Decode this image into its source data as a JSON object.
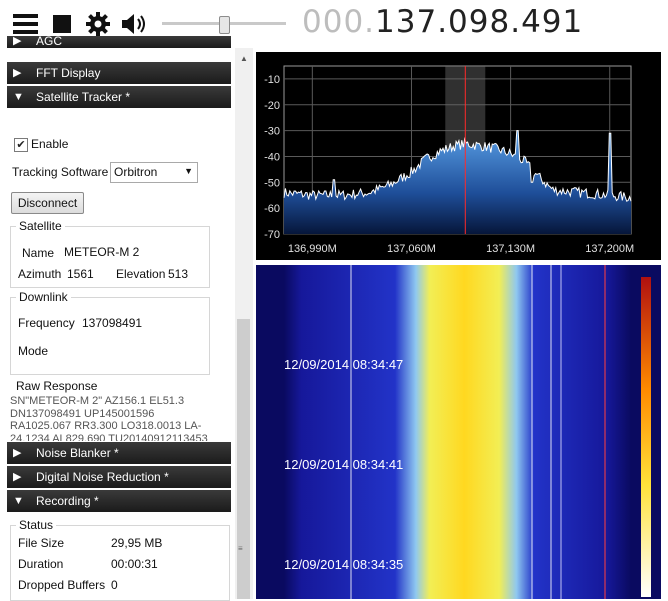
{
  "toolbar": {
    "frequency_dim": "000.",
    "frequency_main": "137.098.491",
    "slider_level": 0.5
  },
  "panels": {
    "agc_partial": "AGC",
    "fft_display": "FFT Display",
    "satellite_tracker": "Satellite Tracker *",
    "noise_blanker": "Noise Blanker *",
    "digital_noise_reduction": "Digital Noise Reduction *",
    "recording": "Recording *"
  },
  "tracker": {
    "enable_label": "Enable",
    "tracking_software_label": "Tracking Software",
    "tracking_software_value": "Orbitron",
    "disconnect_label": "Disconnect",
    "satellite_group": "Satellite",
    "name_label": "Name",
    "name_value": "METEOR-M 2",
    "azimuth_label": "Azimuth",
    "azimuth_value": "1561",
    "elevation_label": "Elevation",
    "elevation_value": "513",
    "downlink_group": "Downlink",
    "frequency_label": "Frequency",
    "frequency_value": "137098491",
    "mode_label": "Mode",
    "raw_response_label": "Raw Response",
    "raw_response_text": "SN\"METEOR-M 2\" AZ156.1 EL51.3\nDN137098491 UP145001596\nRA1025.067 RR3.300 LO318.0013 LA-\n24.1234 AL829.690 TU20140912113453"
  },
  "recording": {
    "status_group": "Status",
    "file_size_label": "File Size",
    "file_size_value": "29,95 MB",
    "duration_label": "Duration",
    "duration_value": "00:00:31",
    "dropped_label": "Dropped Buffers",
    "dropped_value": "0"
  },
  "chart_data": {
    "type": "area",
    "y_ticks": [
      "-10",
      "-20",
      "-30",
      "-40",
      "-50",
      "-60",
      "-70"
    ],
    "x_ticks": [
      "136,990M",
      "137,060M",
      "137,130M",
      "137,200M"
    ],
    "ylim": [
      -70,
      -5
    ],
    "xlim": [
      136.97,
      137.215
    ],
    "grid": true,
    "center_frequency": 137.098,
    "x": [
      136.97,
      136.99,
      137.01,
      137.03,
      137.045,
      137.06,
      137.07,
      137.08,
      137.09,
      137.098,
      137.11,
      137.12,
      137.13,
      137.14,
      137.15,
      137.16,
      137.18,
      137.2,
      137.215
    ],
    "values": [
      -54,
      -55,
      -55,
      -54,
      -51,
      -46,
      -41,
      -38,
      -36,
      -35,
      -36,
      -37,
      -39,
      -42,
      -48,
      -53,
      -54,
      -55,
      -56
    ],
    "spikes": [
      {
        "x": 137.005,
        "y": -49
      },
      {
        "x": 137.135,
        "y": -30
      },
      {
        "x": 137.145,
        "y": -50
      },
      {
        "x": 137.2,
        "y": -31
      }
    ]
  },
  "waterfall": {
    "timestamps": [
      "12/09/2014 08:34:47",
      "12/09/2014 08:34:41",
      "12/09/2014 08:34:35"
    ]
  }
}
